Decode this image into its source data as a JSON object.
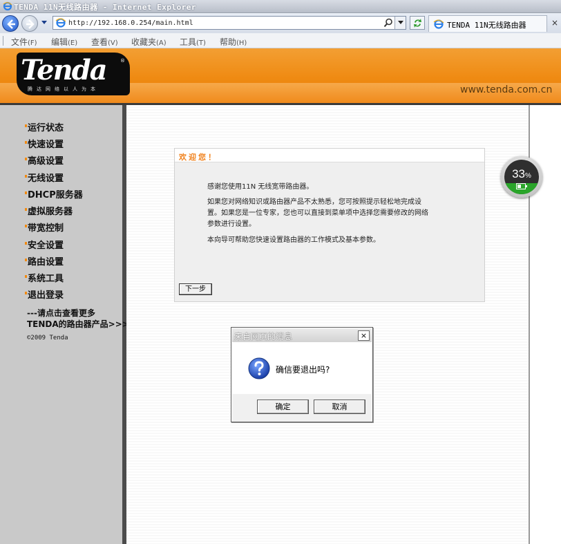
{
  "window": {
    "title": "TENDA 11N无线路由器 - Internet Explorer"
  },
  "addressbar": {
    "url": "http://192.168.0.254/main.html",
    "tab_title": "TENDA 11N无线路由器",
    "tab_close": "×"
  },
  "menubar": {
    "items": [
      {
        "label": "文件",
        "accel": "(F)"
      },
      {
        "label": "编辑",
        "accel": "(E)"
      },
      {
        "label": "查看",
        "accel": "(V)"
      },
      {
        "label": "收藏夹",
        "accel": "(A)"
      },
      {
        "label": "工具",
        "accel": "(T)"
      },
      {
        "label": "帮助",
        "accel": "(H)"
      }
    ]
  },
  "header": {
    "logo": "Tenda",
    "slogan": "腾达网络以人为本",
    "url": "www.tenda.com.cn"
  },
  "sidebar": {
    "items": [
      {
        "label": "运行状态"
      },
      {
        "label": "快速设置"
      },
      {
        "label": "高级设置"
      },
      {
        "label": "无线设置"
      },
      {
        "label": "DHCP服务器"
      },
      {
        "label": "虚拟服务器"
      },
      {
        "label": "带宽控制"
      },
      {
        "label": "安全设置"
      },
      {
        "label": "路由设置"
      },
      {
        "label": "系统工具"
      },
      {
        "label": "退出登录"
      }
    ],
    "more_line1": "---请点击查看更多",
    "more_line2": "TENDA的路由器产品>>>",
    "copyright": "©2009 Tenda"
  },
  "welcome": {
    "title": "欢迎您！",
    "line1": "感谢您使用11N 无线宽带路由器。",
    "line2": "如果您对网络知识或路由器产品不太熟悉，您可按照提示轻松地完成设",
    "line3": "置。如果您是一位专家，您也可以直接到菜单项中选择您需要修改的网络",
    "line4": "参数进行设置。",
    "line5": "本向导可帮助您快速设置路由器的工作模式及基本参数。",
    "next_button": "下一步"
  },
  "battery": {
    "percent": "33",
    "unit": "%",
    "level": 0.33,
    "fill_color": "#2aa52a"
  },
  "dialog": {
    "title": "来自网页的消息",
    "close": "×",
    "message": "确信要退出吗?",
    "ok": "确定",
    "cancel": "取消",
    "icon": "question-icon"
  },
  "colors": {
    "accent_orange": "#f08a12",
    "welcome_title": "#f0821e",
    "sidebar_bg": "#c9c9c9"
  }
}
